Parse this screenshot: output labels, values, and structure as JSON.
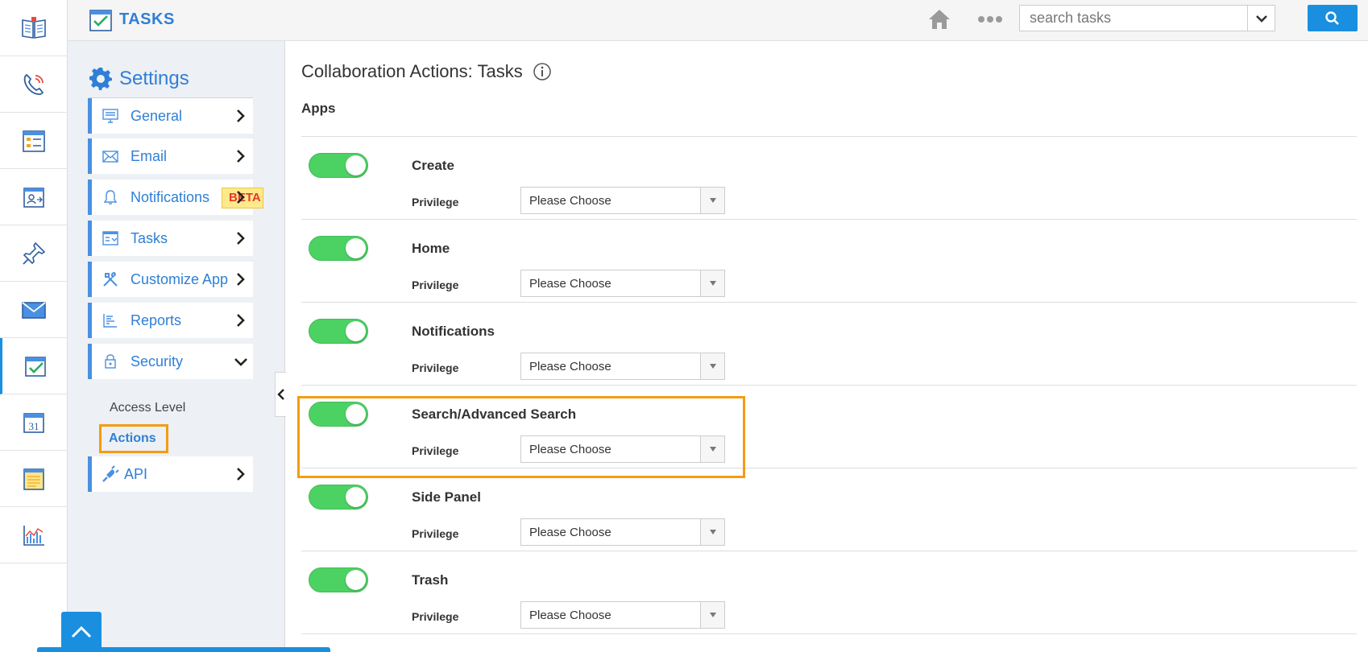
{
  "topbar": {
    "app_title": "TASKS",
    "search_placeholder": "search tasks"
  },
  "rail": {
    "items": [
      {
        "icon": "guide-book-icon"
      },
      {
        "icon": "phone-icon"
      },
      {
        "icon": "form-list-icon"
      },
      {
        "icon": "contacts-icon"
      },
      {
        "icon": "pin-icon"
      },
      {
        "icon": "mail-icon"
      },
      {
        "icon": "tasks-icon",
        "active": true
      },
      {
        "icon": "calendar-icon",
        "text": "31"
      },
      {
        "icon": "notes-icon"
      },
      {
        "icon": "analytics-icon"
      }
    ]
  },
  "sidebar": {
    "title": "Settings",
    "items": [
      {
        "label": "General",
        "icon": "monitor-icon"
      },
      {
        "label": "Email",
        "icon": "envelope-icon"
      },
      {
        "label": "Notifications",
        "icon": "bell-icon",
        "badge": "BETA"
      },
      {
        "label": "Tasks",
        "icon": "task-board-icon"
      },
      {
        "label": "Customize App",
        "icon": "tools-icon"
      },
      {
        "label": "Reports",
        "icon": "reports-icon"
      },
      {
        "label": "Security",
        "icon": "lock-icon",
        "expanded": true
      },
      {
        "label": "API",
        "icon": "plug-icon"
      }
    ],
    "security_subitems": [
      "Access Level",
      "Actions"
    ],
    "active_subitem": "Actions"
  },
  "main": {
    "title": "Collaboration Actions: Tasks",
    "section_title": "Apps",
    "privilege_label": "Privilege",
    "apps": [
      {
        "name": "Create",
        "enabled": true,
        "privilege": "Please Choose"
      },
      {
        "name": "Home",
        "enabled": true,
        "privilege": "Please Choose"
      },
      {
        "name": "Notifications",
        "enabled": true,
        "privilege": "Please Choose"
      },
      {
        "name": "Search/Advanced Search",
        "enabled": true,
        "privilege": "Please Choose",
        "highlighted": true
      },
      {
        "name": "Side Panel",
        "enabled": true,
        "privilege": "Please Choose"
      },
      {
        "name": "Trash",
        "enabled": true,
        "privilege": "Please Choose"
      }
    ]
  },
  "colors": {
    "accent_blue": "#2f7fd6",
    "button_blue": "#1a8fe0",
    "toggle_green": "#4cd263",
    "highlight_orange": "#f39c12",
    "beta_red": "#e03a2f",
    "beta_yellow": "#ffe98a"
  }
}
